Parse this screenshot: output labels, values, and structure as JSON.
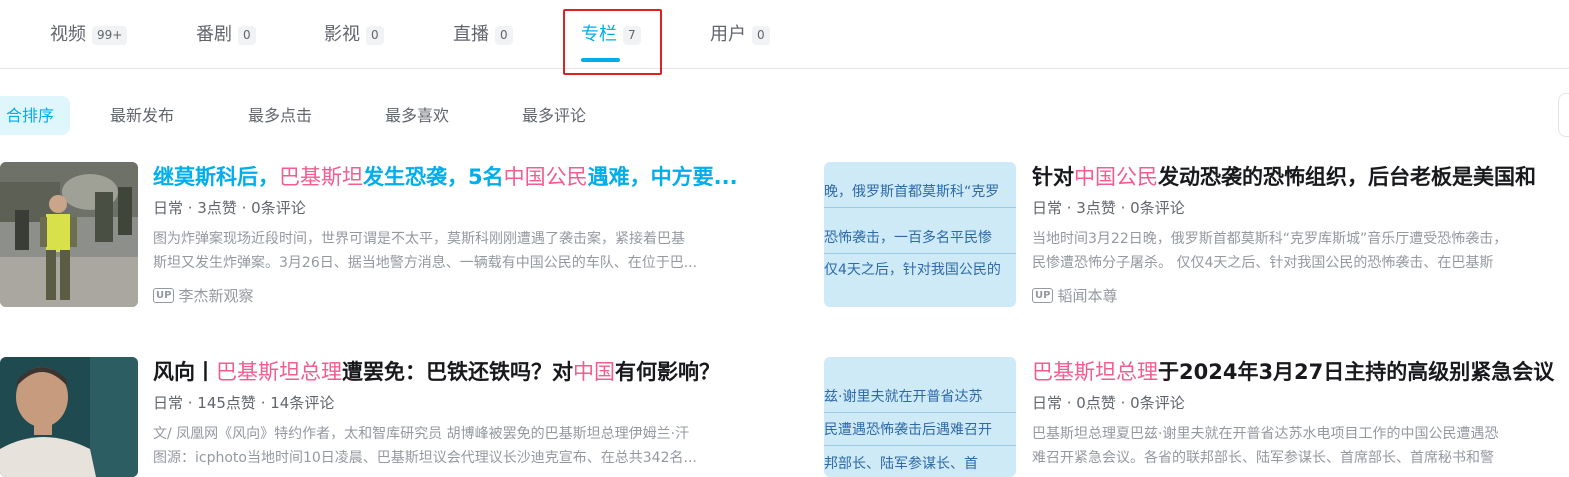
{
  "tabs": [
    {
      "label": "视频",
      "count": "99+"
    },
    {
      "label": "番剧",
      "count": "0"
    },
    {
      "label": "影视",
      "count": "0"
    },
    {
      "label": "直播",
      "count": "0"
    },
    {
      "label": "专栏",
      "count": "7"
    },
    {
      "label": "用户",
      "count": "0"
    }
  ],
  "active_tab": "专栏",
  "sort": [
    "合排序",
    "最新发布",
    "最多点击",
    "最多喜欢",
    "最多评论"
  ],
  "colors": {
    "accent": "#00aeec",
    "keyword": "#f25d8e",
    "highlight_box": "#e02020"
  },
  "articles": [
    {
      "title_parts": [
        "继莫斯科后，",
        "巴基斯坦",
        "发生恐袭，5名",
        "中国公民",
        "遇难，中方要..."
      ],
      "meta": "日常 · 3点赞 · 0条评论",
      "desc1": "图为炸弹案现场近段时间，世界可谓是不太平，莫斯科刚刚遭遇了袭击案，紧接着巴基",
      "desc2": "斯坦又发生炸弹案。3月26日、据当地警方消息、一辆载有中国公民的车队、在位于巴...",
      "author": "李杰新观察"
    },
    {
      "title_parts": [
        "针对",
        "中国公民",
        "发动恐袭的恐怖组织，后台老板是美国和"
      ],
      "meta": "日常 · 3点赞 · 0条评论",
      "desc1": "当地时间3月22日晚，俄罗斯首都莫斯科“克罗库斯城”音乐厅遭受恐怖袭击，",
      "desc2": "民惨遭恐怖分子屠杀。 仅仅4天之后、针对我国公民的恐怖袭击、在巴基斯",
      "author": "韬闻本尊",
      "thumb_lines": [
        "晚，俄罗斯首都莫斯科“克罗",
        "恐怖袭击，一百多名平民惨",
        "仅4天之后，针对我国公民的"
      ]
    },
    {
      "title_parts": [
        "风向丨",
        "巴基斯坦总理",
        "遭罢免：巴铁还铁吗？对",
        "中国",
        "有何影响？"
      ],
      "meta": "日常 · 145点赞 · 14条评论",
      "desc1": "文/ 凤凰网《风向》特约作者，太和智库研究员 胡博峰被罢免的巴基斯坦总理伊姆兰·汗",
      "desc2": "图源：icphoto当地时间10日凌晨、巴基斯坦议会代理议长沙迪克宣布、在总共342名..."
    },
    {
      "title_parts": [
        "巴基斯坦总理",
        "于2024年3月27日主持的高级别紧急会议"
      ],
      "meta": "日常 · 0点赞 · 0条评论",
      "desc1": "巴基斯坦总理夏巴兹·谢里夫就在开普省达苏水电项目工作的中国公民遭遇恐",
      "desc2": "难召开紧急会议。各省的联邦部长、陆军参谋长、首席部长、首席秘书和警",
      "thumb_lines": [
        "兹·谢里夫就在开普省达苏",
        "民遭遇恐怖袭击后遇难召开",
        "邦部长、陆军参谋长、首"
      ]
    }
  ]
}
